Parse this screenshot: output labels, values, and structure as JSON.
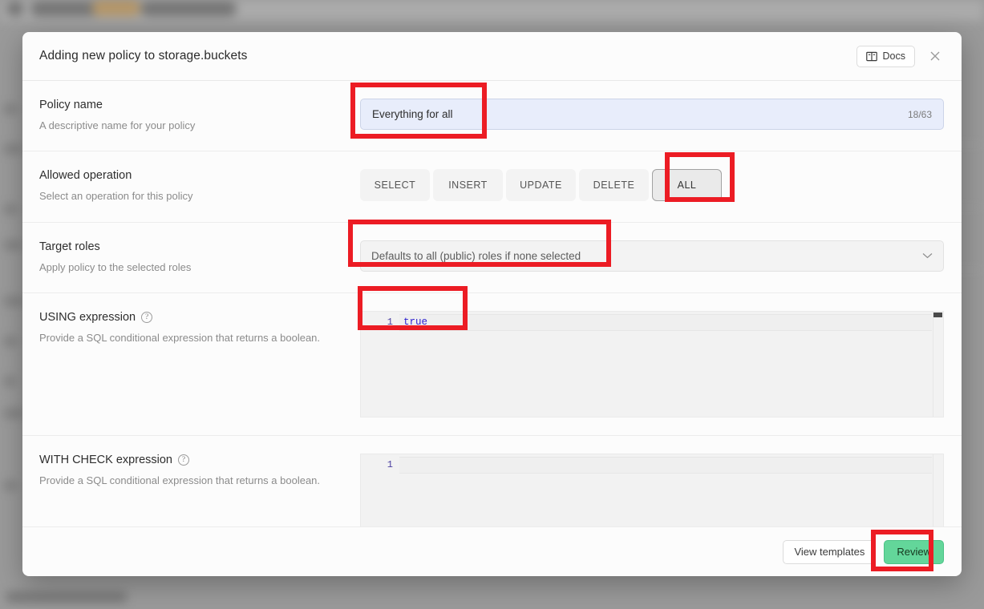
{
  "modal": {
    "title": "Adding new policy to storage.buckets",
    "docs_label": "Docs",
    "docs_icon": "book-icon",
    "close_icon": "close-icon"
  },
  "rows": {
    "policy_name": {
      "title": "Policy name",
      "description": "A descriptive name for your policy",
      "value": "Everything for all",
      "counter": "18/63"
    },
    "allowed_operation": {
      "title": "Allowed operation",
      "description": "Select an operation for this policy",
      "options": [
        "SELECT",
        "INSERT",
        "UPDATE",
        "DELETE",
        "ALL"
      ],
      "selected": "ALL"
    },
    "target_roles": {
      "title": "Target roles",
      "description": "Apply policy to the selected roles",
      "value": "Defaults to all (public) roles if none selected",
      "chevron_icon": "chevron-down-icon"
    },
    "using_expression": {
      "title": "USING expression",
      "help_icon": "help-circle-icon",
      "description": "Provide a SQL conditional expression that returns a boolean.",
      "line_number": "1",
      "code": "true"
    },
    "with_check_expression": {
      "title": "WITH CHECK expression",
      "help_icon": "help-circle-icon",
      "description": "Provide a SQL conditional expression that returns a boolean.",
      "line_number": "1",
      "code": ""
    }
  },
  "footer": {
    "view_templates_label": "View templates",
    "review_label": "Review"
  },
  "colors": {
    "accent_green": "#63d69a",
    "input_blue": "#e8edfb",
    "annotation_red": "#ec1c24",
    "code_blue": "#2b1fd0"
  }
}
